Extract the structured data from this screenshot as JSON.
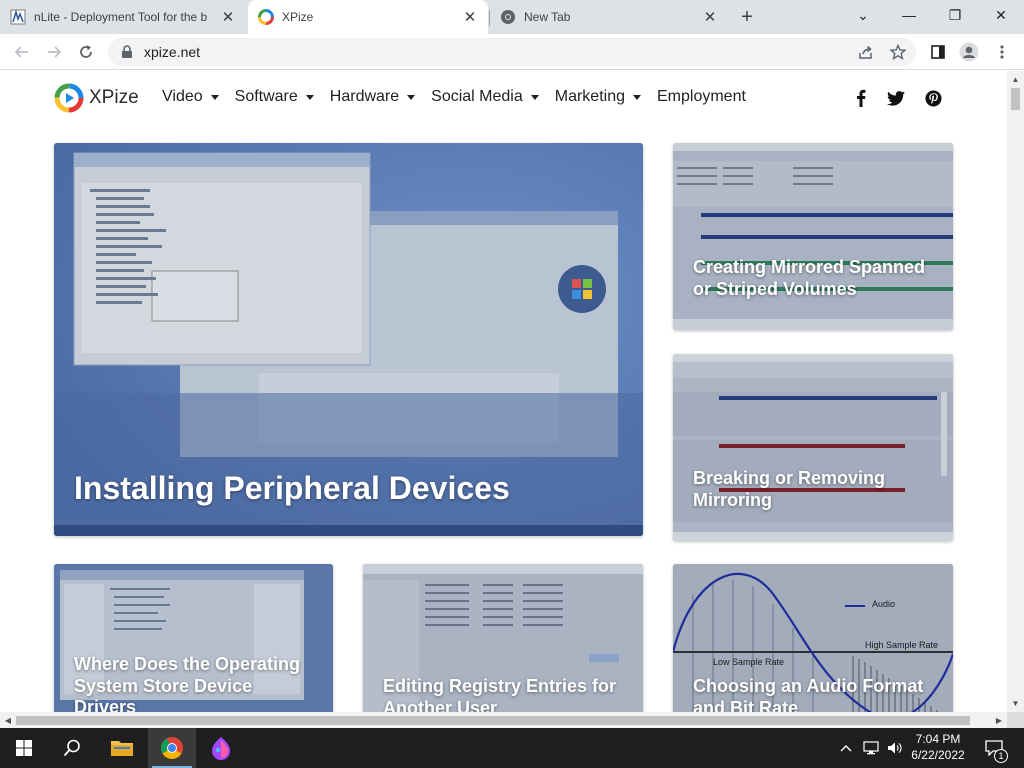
{
  "browser": {
    "tabs": [
      {
        "title": "nLite - Deployment Tool for the b",
        "active": false
      },
      {
        "title": "XPize",
        "active": true
      },
      {
        "title": "New Tab",
        "active": false
      }
    ],
    "url": "xpize.net",
    "new_tab_glyph": "+",
    "window_controls": {
      "minimize": "—",
      "maximize": "❐",
      "close": "✕",
      "tab_list": "⌄"
    }
  },
  "site": {
    "brand": "XPize",
    "nav": [
      {
        "label": "Video",
        "dropdown": true
      },
      {
        "label": "Software",
        "dropdown": true
      },
      {
        "label": "Hardware",
        "dropdown": true
      },
      {
        "label": "Social Media",
        "dropdown": true
      },
      {
        "label": "Marketing",
        "dropdown": true
      },
      {
        "label": "Employment",
        "dropdown": false
      }
    ],
    "social_icons": [
      "facebook-icon",
      "twitter-icon",
      "pinterest-icon"
    ]
  },
  "articles": {
    "featured": {
      "title": "Installing Peripheral Devices"
    },
    "side_top": {
      "title": "Creating Mirrored Spanned or Striped Volumes"
    },
    "side_bottom": {
      "title": "Breaking or Removing Mirroring"
    },
    "row": [
      {
        "title": "Where Does the Operating System Store Device Drivers"
      },
      {
        "title": "Editing Registry Entries for Another User"
      },
      {
        "title": "Choosing an Audio Format and Bit Rate"
      }
    ]
  },
  "thumb_text": {
    "audio_legend": "Audio",
    "audio_high": "High Sample Rate",
    "audio_low": "Low Sample Rate"
  },
  "taskbar": {
    "time": "7:04 PM",
    "date": "6/22/2022",
    "notification_count": "1"
  },
  "colors": {
    "tabstrip": "#dee1e6",
    "taskbar": "#1f1f1f",
    "card_overlay": "#7b8ba6"
  }
}
